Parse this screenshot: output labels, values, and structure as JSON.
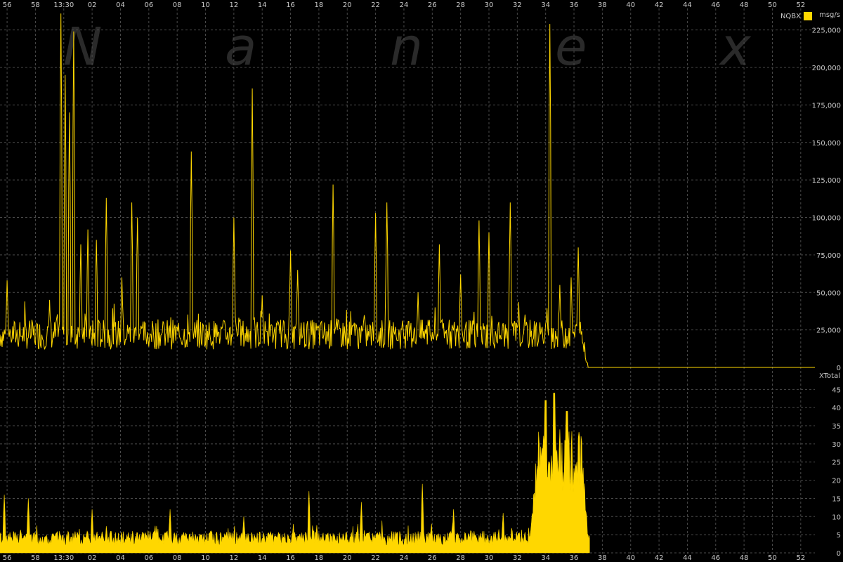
{
  "watermark": [
    "N",
    "a",
    "n",
    "e",
    "x"
  ],
  "x_ticks": [
    "56",
    "58",
    "13:30",
    "02",
    "04",
    "06",
    "08",
    "10",
    "12",
    "14",
    "16",
    "18",
    "20",
    "22",
    "24",
    "26",
    "28",
    "30",
    "32",
    "34",
    "36",
    "38",
    "40",
    "42",
    "44",
    "46",
    "48",
    "50",
    "52"
  ],
  "colors": {
    "series": "#ffd700",
    "background": "#000000",
    "grid": "#4a4a4a",
    "text": "#c8c8c8"
  },
  "chart_data": [
    {
      "type": "line",
      "title": "",
      "unit_label": "msg/s",
      "legend": [
        {
          "name": "NQBX",
          "color": "#ffd700",
          "placement": "top-right"
        }
      ],
      "ylim": [
        0,
        230000
      ],
      "y_ticks": [
        "0",
        "25,000",
        "50,000",
        "75,000",
        "100,000",
        "125,000",
        "150,000",
        "175,000",
        "200,000",
        "225,000"
      ],
      "y_tick_values": [
        0,
        25000,
        50000,
        75000,
        100000,
        125000,
        150000,
        175000,
        200000,
        225000
      ],
      "grid": true,
      "x_range_minutes": [
        "12:55:30",
        "13:53:00"
      ],
      "baseline": 22000,
      "noise": 10000,
      "seed": 7,
      "samples_per_minute": 20,
      "data_end_minute": 41.5,
      "series": [
        {
          "name": "NQBX",
          "color": "#ffd700"
        }
      ],
      "spikes": [
        {
          "t": 0.5,
          "v": 58000
        },
        {
          "t": 3.5,
          "v": 45000
        },
        {
          "t": 4.3,
          "v": 236000
        },
        {
          "t": 4.6,
          "v": 195000
        },
        {
          "t": 4.9,
          "v": 170000
        },
        {
          "t": 5.2,
          "v": 224000
        },
        {
          "t": 5.7,
          "v": 82000
        },
        {
          "t": 6.2,
          "v": 92000
        },
        {
          "t": 6.8,
          "v": 85000
        },
        {
          "t": 7.5,
          "v": 113000
        },
        {
          "t": 8.6,
          "v": 60000
        },
        {
          "t": 9.3,
          "v": 110000
        },
        {
          "t": 9.7,
          "v": 100000
        },
        {
          "t": 13.5,
          "v": 144000
        },
        {
          "t": 16.5,
          "v": 100000
        },
        {
          "t": 17.8,
          "v": 186000
        },
        {
          "t": 18.5,
          "v": 48000
        },
        {
          "t": 20.5,
          "v": 78000
        },
        {
          "t": 21.0,
          "v": 65000
        },
        {
          "t": 23.5,
          "v": 122000
        },
        {
          "t": 26.5,
          "v": 103000
        },
        {
          "t": 27.3,
          "v": 110000
        },
        {
          "t": 29.5,
          "v": 50000
        },
        {
          "t": 31.0,
          "v": 82000
        },
        {
          "t": 32.5,
          "v": 62000
        },
        {
          "t": 33.8,
          "v": 98000
        },
        {
          "t": 34.5,
          "v": 90000
        },
        {
          "t": 36.0,
          "v": 110000
        },
        {
          "t": 38.8,
          "v": 229000
        },
        {
          "t": 39.5,
          "v": 55000
        },
        {
          "t": 40.3,
          "v": 60000
        },
        {
          "t": 40.8,
          "v": 80000
        }
      ]
    },
    {
      "type": "area",
      "title": "",
      "unit_label": "XTotal",
      "ylim": [
        0,
        47
      ],
      "y_ticks": [
        "0",
        "5",
        "10",
        "15",
        "20",
        "25",
        "30",
        "35",
        "40",
        "45"
      ],
      "y_tick_values": [
        0,
        5,
        10,
        15,
        20,
        25,
        30,
        35,
        40,
        45
      ],
      "grid": true,
      "x_range_minutes": [
        "12:55:30",
        "13:53:00"
      ],
      "baseline": 4,
      "noise": 2,
      "seed": 13,
      "samples_per_minute": 20,
      "data_end_minute": 41.6,
      "series": [
        {
          "name": "XTotal",
          "color": "#ffd700"
        }
      ],
      "spikes": [
        {
          "t": 0.3,
          "v": 16
        },
        {
          "t": 2.0,
          "v": 15
        },
        {
          "t": 6.5,
          "v": 12
        },
        {
          "t": 12.0,
          "v": 12
        },
        {
          "t": 17.2,
          "v": 10
        },
        {
          "t": 21.8,
          "v": 17
        },
        {
          "t": 25.5,
          "v": 14
        },
        {
          "t": 29.8,
          "v": 19
        },
        {
          "t": 32.0,
          "v": 12
        },
        {
          "t": 35.5,
          "v": 11
        }
      ],
      "surge": {
        "start": 37.3,
        "end": 41.6,
        "level": 30,
        "peaks": [
          {
            "t": 38.5,
            "v": 42
          },
          {
            "t": 39.1,
            "v": 44
          },
          {
            "t": 40.0,
            "v": 39
          }
        ]
      }
    }
  ]
}
